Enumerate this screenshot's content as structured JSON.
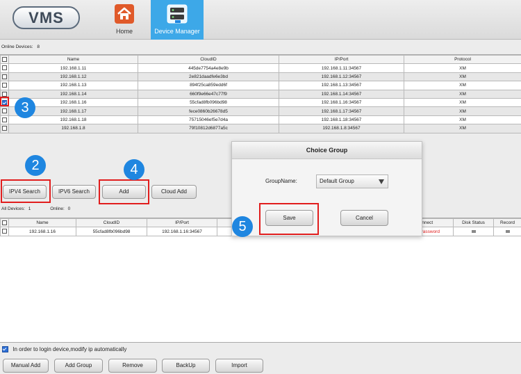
{
  "header": {
    "logo": "VMS",
    "nav": [
      {
        "label": "Home",
        "icon": "home-icon",
        "active": false,
        "color": "#e05a2a"
      },
      {
        "label": "Device Manager",
        "icon": "device-manager-icon",
        "active": true,
        "color": "#3da8e8"
      }
    ]
  },
  "online_devices": {
    "label": "Online Devices:",
    "count": "8"
  },
  "top_table": {
    "columns": [
      "Name",
      "CloudID",
      "IP/Port",
      "Protocol"
    ],
    "rows": [
      {
        "checked": false,
        "name": "192.168.1.11",
        "cloud_id": "445de7754a4e8e9b",
        "ip_port": "192.168.1.11:34567",
        "protocol": "XM"
      },
      {
        "checked": false,
        "name": "192.168.1.12",
        "cloud_id": "2e821daadfe6e3bd",
        "ip_port": "192.168.1.12:34567",
        "protocol": "XM"
      },
      {
        "checked": false,
        "name": "192.168.1.13",
        "cloud_id": "894f25ca859edd6f",
        "ip_port": "192.168.1.13:34567",
        "protocol": "XM"
      },
      {
        "checked": false,
        "name": "192.168.1.14",
        "cloud_id": "660f9e66e47c77f9",
        "ip_port": "192.168.1.14:34567",
        "protocol": "XM"
      },
      {
        "checked": true,
        "name": "192.168.1.16",
        "cloud_id": "55cfad8fb096bd98",
        "ip_port": "192.168.1.16:34567",
        "protocol": "XM"
      },
      {
        "checked": false,
        "name": "192.168.1.17",
        "cloud_id": "fece0860b26678d5",
        "ip_port": "192.168.1.17:34567",
        "protocol": "XM"
      },
      {
        "checked": false,
        "name": "192.168.1.18",
        "cloud_id": "75715046ef5e7d4a",
        "ip_port": "192.168.1.18:34567",
        "protocol": "XM"
      },
      {
        "checked": false,
        "name": "192.168.1.8",
        "cloud_id": "79f10812d6877a5c",
        "ip_port": "192.168.1.8:34567",
        "protocol": "XM"
      }
    ]
  },
  "search_buttons": {
    "ipv4": "IPV4 Search",
    "ipv6": "IPV6 Search",
    "add": "Add",
    "cloud_add": "Cloud Add"
  },
  "summary": {
    "all_label": "All Devices:",
    "all_count": "1",
    "online_label": "Online:",
    "online_count": "0"
  },
  "bottom_table": {
    "columns": {
      "name": "Name",
      "cloud_id": "CloudID",
      "ip_port": "IP/Port",
      "connect": "Connect",
      "disk_status": "Disk Status",
      "record": "Record"
    },
    "rows": [
      {
        "checked": false,
        "name": "192.168.1.16",
        "cloud_id": "55cfad8fb096bd98",
        "ip_port": "192.168.1.16:34567",
        "connect": "d Password"
      }
    ],
    "connect_error_color": "#e11d1d"
  },
  "steps": [
    "3",
    "2",
    "4",
    "5"
  ],
  "highlight_color": "#e11d1d",
  "step_color": "#1f86e0",
  "dialog": {
    "title": "Choice Group",
    "group_label": "GroupName:",
    "group_value": "Default Group",
    "save": "Save",
    "cancel": "Cancel"
  },
  "footer": {
    "auto_modify_checked": true,
    "auto_modify_label": "In order to login device,modify ip automatically",
    "buttons": [
      "Manual Add",
      "Add Group",
      "Remove",
      "BackUp",
      "Import"
    ]
  }
}
